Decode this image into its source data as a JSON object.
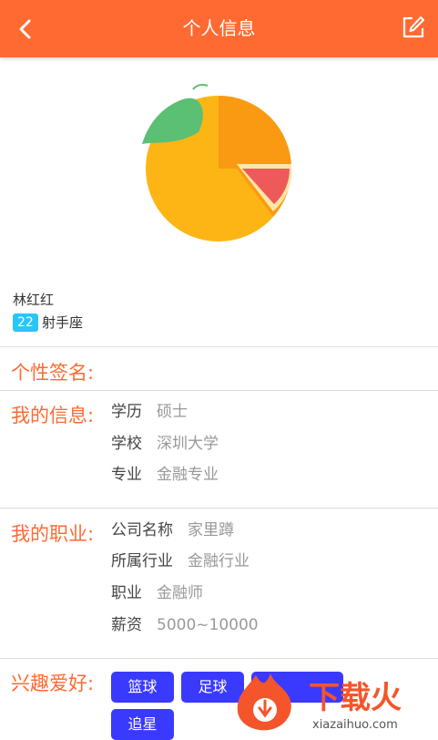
{
  "header": {
    "title": "个人信息",
    "back_icon": "chevron-left-icon",
    "edit_icon": "edit-icon",
    "color": "#ff6a33"
  },
  "profile": {
    "avatar_icon": "orange-fruit-icon",
    "name": "林红红",
    "age": "22",
    "zodiac": "射手座"
  },
  "signature": {
    "label": "个性签名:"
  },
  "info": {
    "label": "我的信息:",
    "rows": [
      {
        "key": "学历",
        "value": "硕士"
      },
      {
        "key": "学校",
        "value": "深圳大学"
      },
      {
        "key": "专业",
        "value": "金融专业"
      }
    ]
  },
  "career": {
    "label": "我的职业:",
    "rows": [
      {
        "key": "公司名称",
        "value": "家里蹲"
      },
      {
        "key": "所属行业",
        "value": "金融行业"
      },
      {
        "key": "职业",
        "value": "金融师"
      },
      {
        "key": "薪资",
        "value": "5000~10000"
      }
    ]
  },
  "hobbies": {
    "label": "兴趣爱好:",
    "tags": [
      "篮球",
      "足球",
      "",
      "追星"
    ]
  },
  "watermark": {
    "brand": "下载火",
    "url": "xiazaihuo.com"
  }
}
